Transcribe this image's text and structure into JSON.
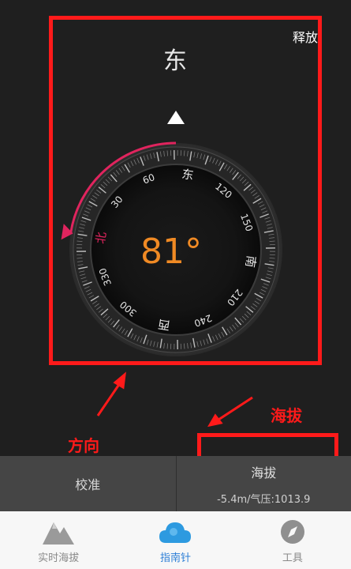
{
  "top_bar": {
    "release_label": "释放"
  },
  "compass": {
    "direction": "东",
    "heading": "81°",
    "heading_degrees": 81,
    "accent_color": "#e0245e",
    "heading_color": "#f08a24",
    "ticks": [
      {
        "label": "北",
        "angle": 0,
        "cardinal": true,
        "accent": true
      },
      {
        "label": "30",
        "angle": 30
      },
      {
        "label": "60",
        "angle": 60
      },
      {
        "label": "东",
        "angle": 90,
        "cardinal": true
      },
      {
        "label": "120",
        "angle": 120
      },
      {
        "label": "150",
        "angle": 150
      },
      {
        "label": "南",
        "angle": 180,
        "cardinal": true
      },
      {
        "label": "210",
        "angle": 210
      },
      {
        "label": "240",
        "angle": 240
      },
      {
        "label": "西",
        "angle": 270,
        "cardinal": true
      },
      {
        "label": "300",
        "angle": 300
      },
      {
        "label": "330",
        "angle": 330
      }
    ]
  },
  "annotations": {
    "direction_note": "方向",
    "altitude_note": "海拔",
    "color": "#ff1a1a"
  },
  "bottom_panel": {
    "calibrate_label": "校准",
    "altitude_title": "海拔",
    "altitude_value": "-5.4m/气压:1013.9"
  },
  "tabbar": {
    "tabs": [
      {
        "label": "实时海拔",
        "icon": "mountain-icon",
        "active": false
      },
      {
        "label": "指南针",
        "icon": "cloud-icon",
        "active": true
      },
      {
        "label": "工具",
        "icon": "compass-tool-icon",
        "active": false
      }
    ],
    "active_color": "#2d7fd6"
  }
}
